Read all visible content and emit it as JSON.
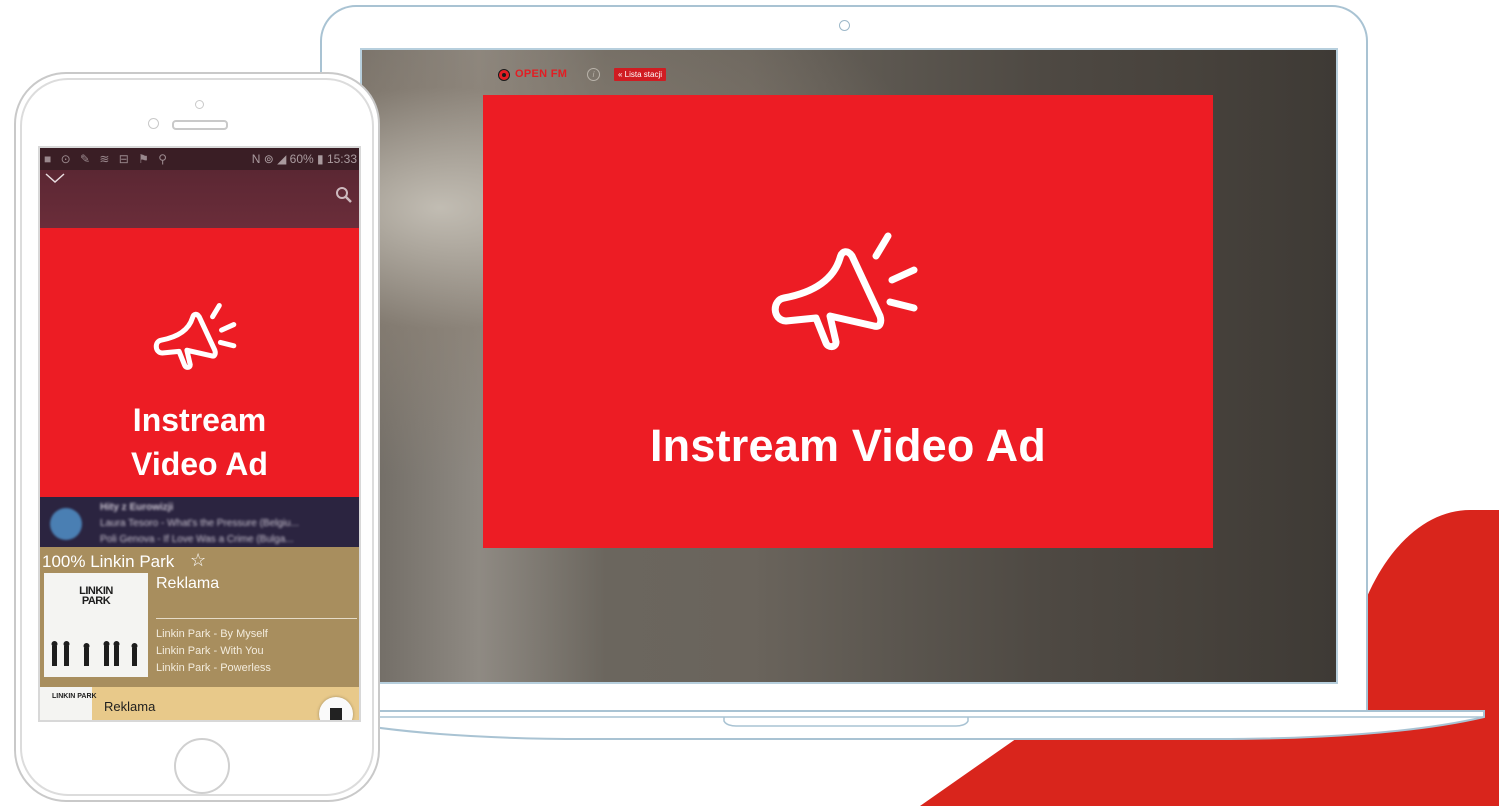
{
  "laptop": {
    "brand_name": "OPEN FM",
    "info_icon": "i",
    "station_list_label": "« Lista stacji",
    "ad_text": "Instream Video Ad"
  },
  "phone": {
    "status_bar_left": "■ ⊙ ✎ ≋ ⊟ ⚑ ⚲",
    "status_bar_right": "N ⊚ ◢ 60% ▮ 15:33",
    "ad_line_1": "Instream",
    "ad_line_2": "Video Ad",
    "blurred_row": {
      "title": "Hity z Eurowizji",
      "line_1": "Laura Tesoro - What's the Pressure (Belgiu...",
      "line_2": "Poli Genova - If Love Was a Crime (Bulga..."
    },
    "station_title": "100% Linkin Park",
    "star_icon": "☆",
    "album_art_text": "LINKIN PARK",
    "now_playing": "Reklama",
    "tracks": [
      "Linkin Park - By Myself",
      "Linkin Park - With You",
      "Linkin Park - Powerless"
    ],
    "player_label": "Reklama",
    "player_thumb_text": "LINKIN PARK"
  },
  "colors": {
    "ad_red": "#ed1c24",
    "brand_red": "#e31d23",
    "station_bg": "#a88e5e",
    "player_bg": "#e8c98a"
  }
}
